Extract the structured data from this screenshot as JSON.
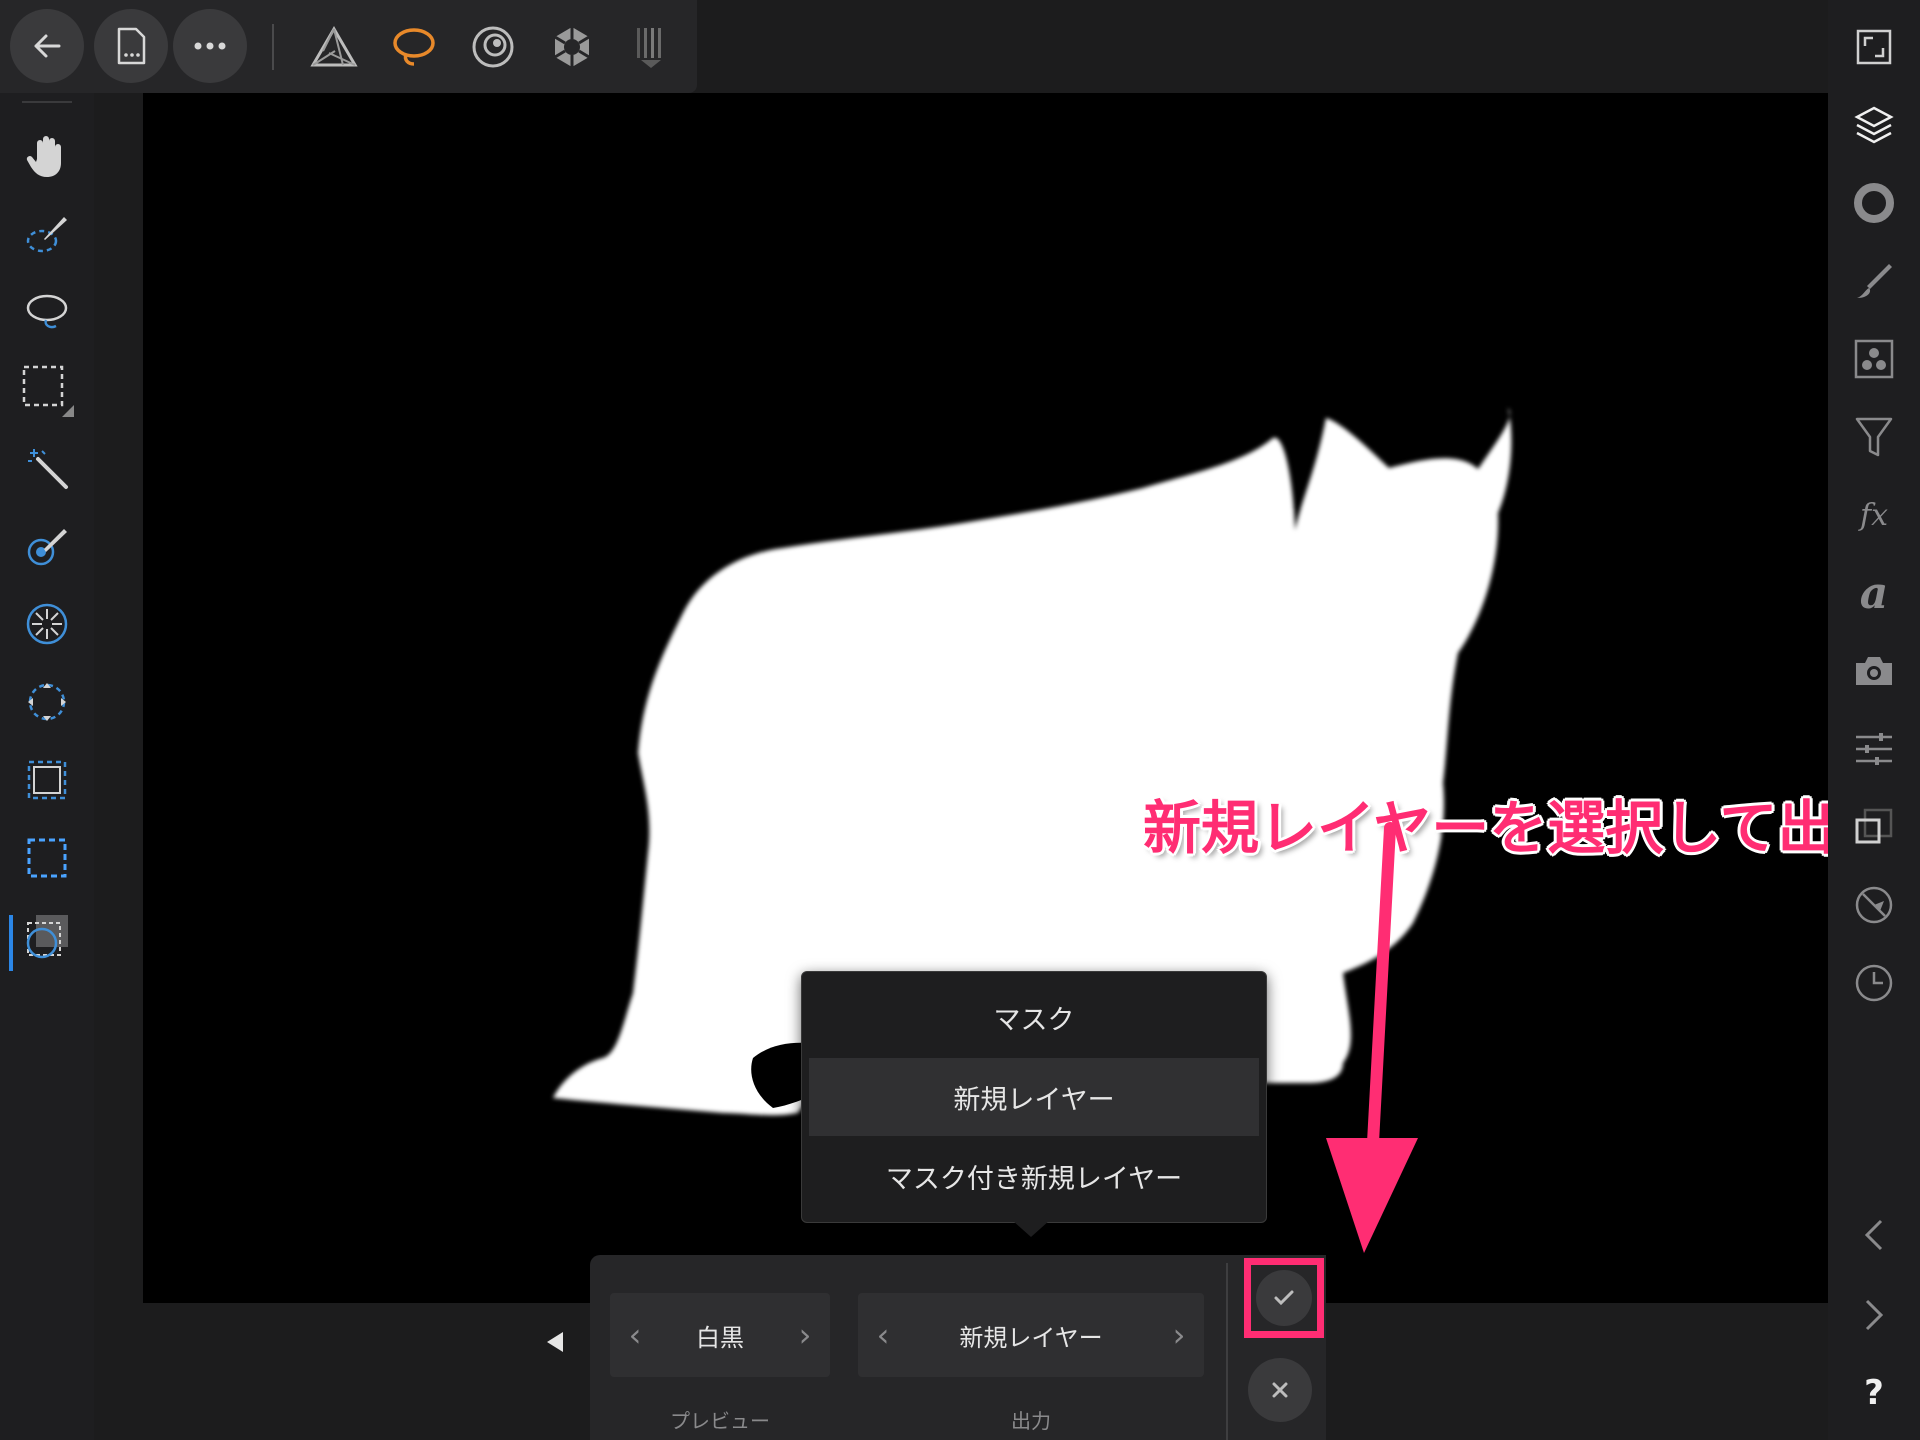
{
  "toolbar": {
    "back_icon": "arrow-left-icon",
    "document_icon": "document-icon",
    "more_icon": "more-icon",
    "personas": [
      "photo-persona-icon",
      "liquify-persona-icon",
      "develop-persona-icon",
      "tone-map-persona-icon",
      "export-persona-icon"
    ],
    "active_persona_color": "#e8892a"
  },
  "left_tools": [
    "hand-icon",
    "selection-brush-icon",
    "freehand-selection-icon",
    "marquee-selection-icon",
    "flood-select-icon",
    "refine-brush-icon",
    "radial-icon",
    "transform-selection-icon",
    "crop-selection-icon",
    "rectangle-selection-icon",
    "selection-mode-icon"
  ],
  "studio_icons": [
    "fullscreen-icon",
    "layers-icon",
    "color-icon",
    "brush-icon",
    "channels-icon",
    "adjustments-icon",
    "fx-icon",
    "text-styles-icon",
    "camera-icon",
    "sliders-icon",
    "transform-icon",
    "navigator-icon",
    "history-icon"
  ],
  "studio_nav": {
    "prev_icon": "chevron-left-icon",
    "next_icon": "chevron-right-icon",
    "help_label": "?"
  },
  "popup": {
    "items": [
      "マスク",
      "新規レイヤー",
      "マスク付き新規レイヤー"
    ],
    "selected_index": 1
  },
  "bottom_panel": {
    "preview": {
      "value": "白黒",
      "label": "プレビュー"
    },
    "output": {
      "value": "新規レイヤー",
      "label": "出力"
    },
    "expand_icon": "triangle-left-icon",
    "apply_icon": "check-icon",
    "cancel_icon": "close-icon"
  },
  "annotation": {
    "text": "新規レイヤーを選択して出力",
    "color": "#ff2d73"
  }
}
